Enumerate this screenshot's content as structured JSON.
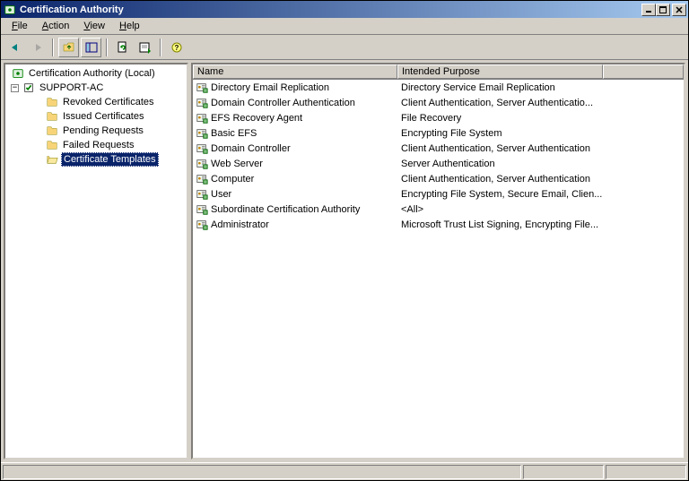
{
  "window": {
    "title": "Certification Authority"
  },
  "menu": {
    "file": "File",
    "action": "Action",
    "view": "View",
    "help": "Help"
  },
  "tree": {
    "root": "Certification Authority (Local)",
    "server": "SUPPORT-AC",
    "items": [
      "Revoked Certificates",
      "Issued Certificates",
      "Pending Requests",
      "Failed Requests",
      "Certificate Templates"
    ]
  },
  "columns": {
    "name": "Name",
    "purpose": "Intended Purpose"
  },
  "rows": [
    {
      "name": "Directory Email Replication",
      "purpose": "Directory Service Email Replication"
    },
    {
      "name": "Domain Controller Authentication",
      "purpose": "Client Authentication, Server Authenticatio..."
    },
    {
      "name": "EFS Recovery Agent",
      "purpose": "File Recovery"
    },
    {
      "name": "Basic EFS",
      "purpose": "Encrypting File System"
    },
    {
      "name": "Domain Controller",
      "purpose": "Client Authentication, Server Authentication"
    },
    {
      "name": "Web Server",
      "purpose": "Server Authentication"
    },
    {
      "name": "Computer",
      "purpose": "Client Authentication, Server Authentication"
    },
    {
      "name": "User",
      "purpose": "Encrypting File System, Secure Email, Clien..."
    },
    {
      "name": "Subordinate Certification Authority",
      "purpose": "<All>"
    },
    {
      "name": "Administrator",
      "purpose": "Microsoft Trust List Signing, Encrypting File..."
    }
  ],
  "minus": "−"
}
